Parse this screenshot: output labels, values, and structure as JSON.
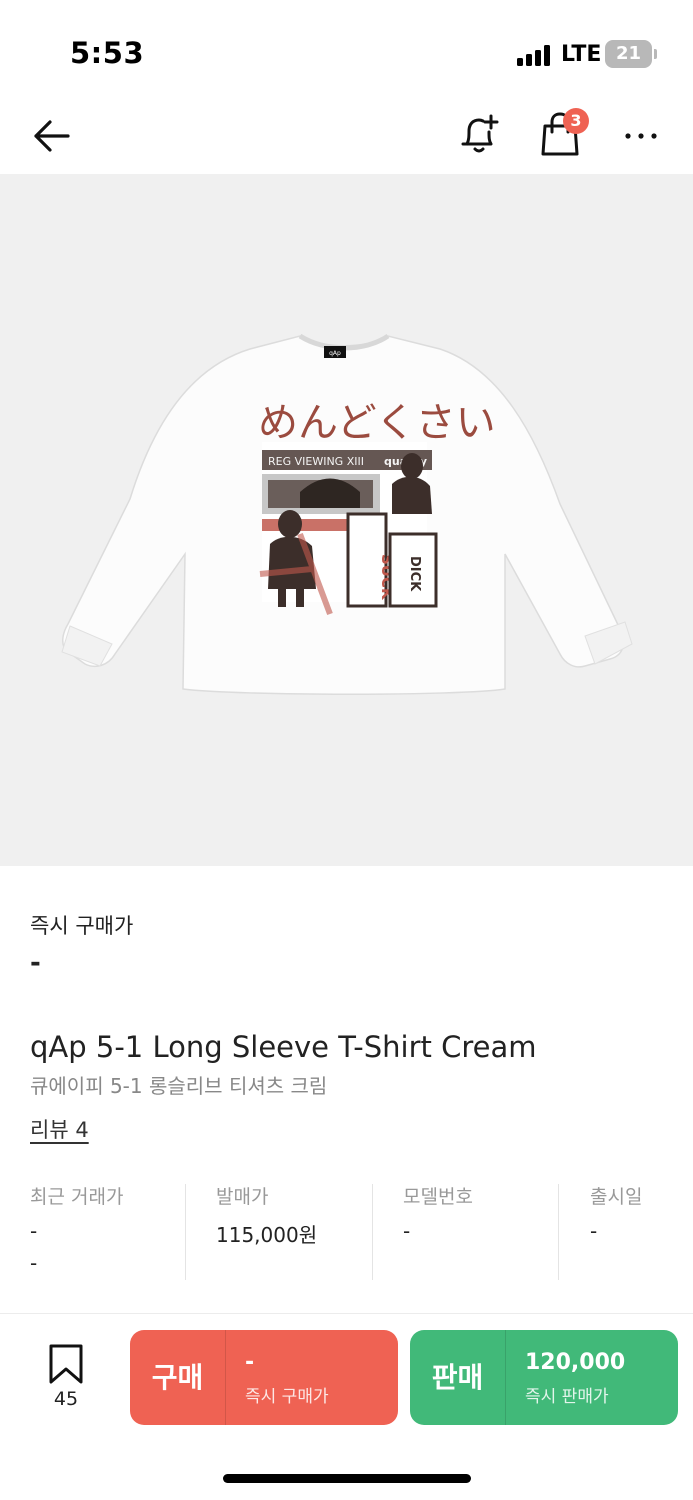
{
  "status_bar": {
    "time": "5:53",
    "network": "LTE",
    "battery": "21"
  },
  "nav": {
    "cart_count": "3",
    "icons": [
      "arrow-left-icon",
      "bell-plus-icon",
      "shopping-bag-icon",
      "more-horizontal-icon"
    ]
  },
  "product": {
    "instant_buy_label": "즉시 구매가",
    "instant_buy_value": "-",
    "title_en": "qAp 5-1 Long Sleeve T-Shirt Cream",
    "title_ko": "큐에이피 5-1 롱슬리브 티셔츠 크림",
    "review_link": "리뷰 4",
    "image_text": {
      "hiragana": "めんどくさい",
      "tag": "qAp",
      "banner": "REG VIEWING XIII",
      "sign": "quality",
      "stamp_left": "SUCK",
      "stamp_right": "DICK"
    }
  },
  "specs": [
    {
      "label": "최근 거래가",
      "value": "-",
      "value2": "-"
    },
    {
      "label": "발매가",
      "value": "115,000원"
    },
    {
      "label": "모델번호",
      "value": "-"
    },
    {
      "label": "출시일",
      "value": "-"
    }
  ],
  "bottom": {
    "wish_count": "45",
    "buy": {
      "label": "구매",
      "price": "-",
      "sub": "즉시 구매가"
    },
    "sell": {
      "label": "판매",
      "price": "120,000",
      "sub": "즉시 판매가"
    }
  },
  "colors": {
    "buy": "#ef6253",
    "sell": "#41b979",
    "badge": "#ef6253",
    "image_bg": "#f0f0f0"
  }
}
